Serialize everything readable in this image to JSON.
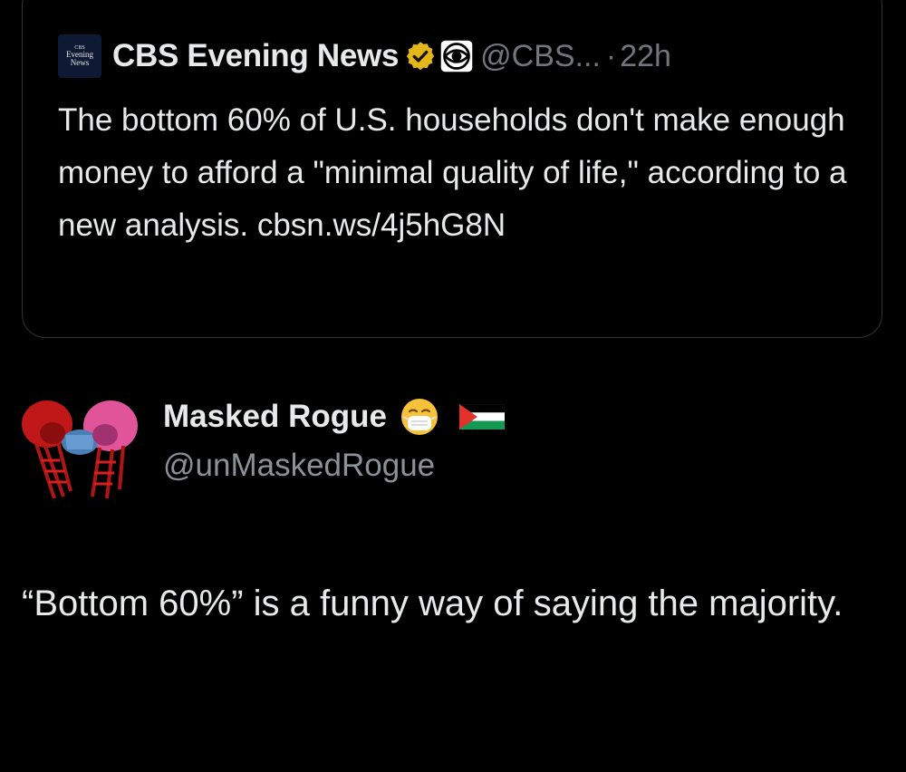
{
  "quoted_tweet": {
    "logo_lines": [
      "CBS",
      "Evening",
      "News"
    ],
    "author_name": "CBS Evening News",
    "handle": "@CBS...",
    "separator": "·",
    "time": "22h",
    "text": "The bottom 60% of U.S. households don't make enough money to afford a \"minimal quality of life,\" according to a new analysis. cbsn.ws/4j5hG8N",
    "verified_badge_color": "#e2b719",
    "affiliate_icon": "cbs-eye-icon"
  },
  "reply": {
    "author_name": "Masked Rogue",
    "handle": "@unMaskedRogue",
    "emoji": "face-with-medical-mask",
    "flag": "palestine-flag",
    "text": "“Bottom 60%” is a funny way of saying the majority."
  },
  "colors": {
    "background": "#000000",
    "text": "#e7e9ea",
    "muted": "#71767b",
    "border": "#2f3336"
  }
}
